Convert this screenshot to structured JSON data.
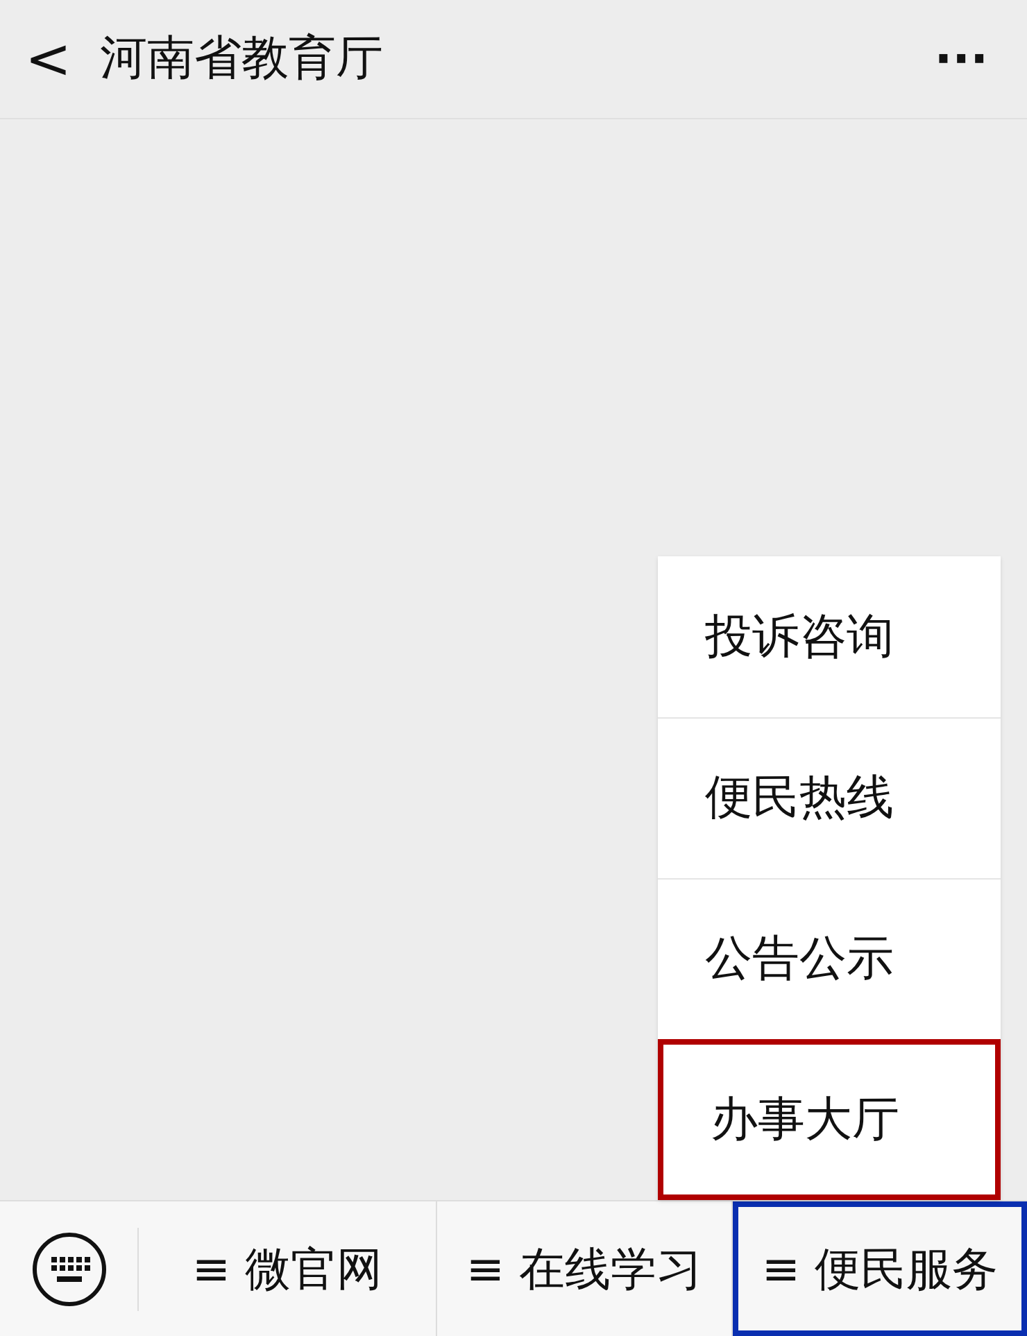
{
  "header": {
    "back": "<",
    "title": "河南省教育厅",
    "more": "···"
  },
  "popup_menu": {
    "items": [
      {
        "label": "投诉咨询",
        "highlighted": false
      },
      {
        "label": "便民热线",
        "highlighted": false
      },
      {
        "label": "公告公示",
        "highlighted": false
      },
      {
        "label": "办事大厅",
        "highlighted": true
      }
    ]
  },
  "bottom_menu": {
    "items": [
      {
        "label": "≡ 微官网",
        "highlighted": false
      },
      {
        "label": "≡ 在线学习",
        "highlighted": false
      },
      {
        "label": "≡ 便民服务",
        "highlighted": true
      }
    ]
  }
}
